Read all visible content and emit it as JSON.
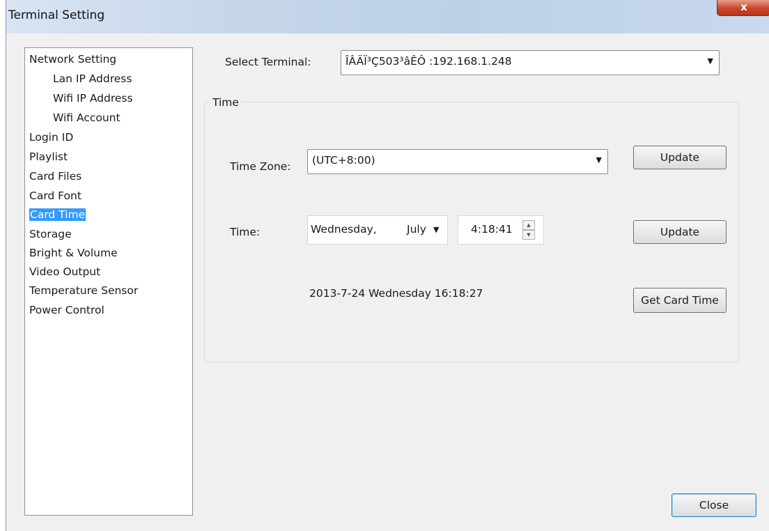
{
  "window": {
    "title": "Terminal Setting",
    "close_glyph": "x"
  },
  "tree": {
    "items": [
      {
        "label": "Network Setting",
        "level": 0
      },
      {
        "label": "Lan IP Address",
        "level": 1
      },
      {
        "label": "Wifi IP Address",
        "level": 1
      },
      {
        "label": "Wifi Account",
        "level": 1
      },
      {
        "label": "Login ID",
        "level": 0
      },
      {
        "label": "Playlist",
        "level": 0
      },
      {
        "label": "Card Files",
        "level": 0
      },
      {
        "label": "Card Font",
        "level": 0
      },
      {
        "label": "Card Time",
        "level": 0,
        "selected": true
      },
      {
        "label": "Storage",
        "level": 0
      },
      {
        "label": "Bright & Volume",
        "level": 0
      },
      {
        "label": "Video Output",
        "level": 0
      },
      {
        "label": "Temperature Sensor",
        "level": 0
      },
      {
        "label": "Power Control",
        "level": 0
      }
    ]
  },
  "select_terminal": {
    "label": "Select Terminal:",
    "value": "ÎÂÄÏ³Ç503³âÊÔ :192.168.1.248"
  },
  "time_group": {
    "title": "Time",
    "time_zone_label": "Time Zone:",
    "time_zone_value": "(UTC+8:00)",
    "update_button_1": "Update",
    "time_label": "Time:",
    "date_day": "Wednesday,",
    "date_month": "July",
    "time_value": "4:18:41",
    "update_button_2": "Update",
    "card_time_readout": "2013-7-24 Wednesday 16:18:27",
    "get_card_time_button": "Get Card Time"
  },
  "footer": {
    "close_button": "Close"
  },
  "colors": {
    "selection": "#3399ff",
    "close_red": "#c8452a"
  }
}
